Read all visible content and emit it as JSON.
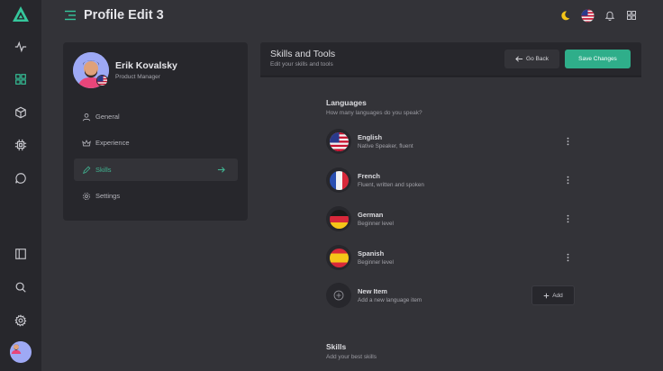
{
  "app": {
    "title": "Profile Edit 3"
  },
  "colors": {
    "accent": "#2fae8a",
    "rail_bg": "#27272c",
    "page_bg": "#333338"
  },
  "rail": {
    "logo": "logo-triangle-icon",
    "items": [
      "activity-icon",
      "grid-icon",
      "cube-icon",
      "chip-icon",
      "chat-icon"
    ],
    "bottom_items": [
      "sidebar-toggle-icon",
      "search-icon",
      "settings-icon"
    ]
  },
  "topbar": {
    "icons": [
      "moon-icon",
      "us-flag-icon",
      "bell-icon",
      "apps-grid-icon"
    ]
  },
  "profile": {
    "name": "Erik Kovalsky",
    "role": "Product Manager",
    "nav": [
      {
        "label": "General",
        "icon": "user-icon",
        "active": false
      },
      {
        "label": "Experience",
        "icon": "crown-icon",
        "active": false
      },
      {
        "label": "Skills",
        "icon": "pen-icon",
        "active": true
      },
      {
        "label": "Settings",
        "icon": "gear-icon",
        "active": false
      }
    ]
  },
  "main": {
    "title": "Skills and Tools",
    "subtitle": "Edit your skills and tools",
    "back_label": "Go Back",
    "save_label": "Save Changes",
    "languages": {
      "title": "Languages",
      "subtitle": "How many languages do you speak?",
      "items": [
        {
          "name": "English",
          "level": "Native Speaker, fluent",
          "flag": "us-flag-icon"
        },
        {
          "name": "French",
          "level": "Fluent, written and spoken",
          "flag": "fr-flag-icon"
        },
        {
          "name": "German",
          "level": "Beginner level",
          "flag": "de-flag-icon"
        },
        {
          "name": "Spanish",
          "level": "Beginner level",
          "flag": "es-flag-icon"
        }
      ],
      "new_item": {
        "name": "New Item",
        "desc": "Add a new language item",
        "button": "Add"
      }
    },
    "skills": {
      "title": "Skills",
      "subtitle": "Add your best skills"
    }
  }
}
